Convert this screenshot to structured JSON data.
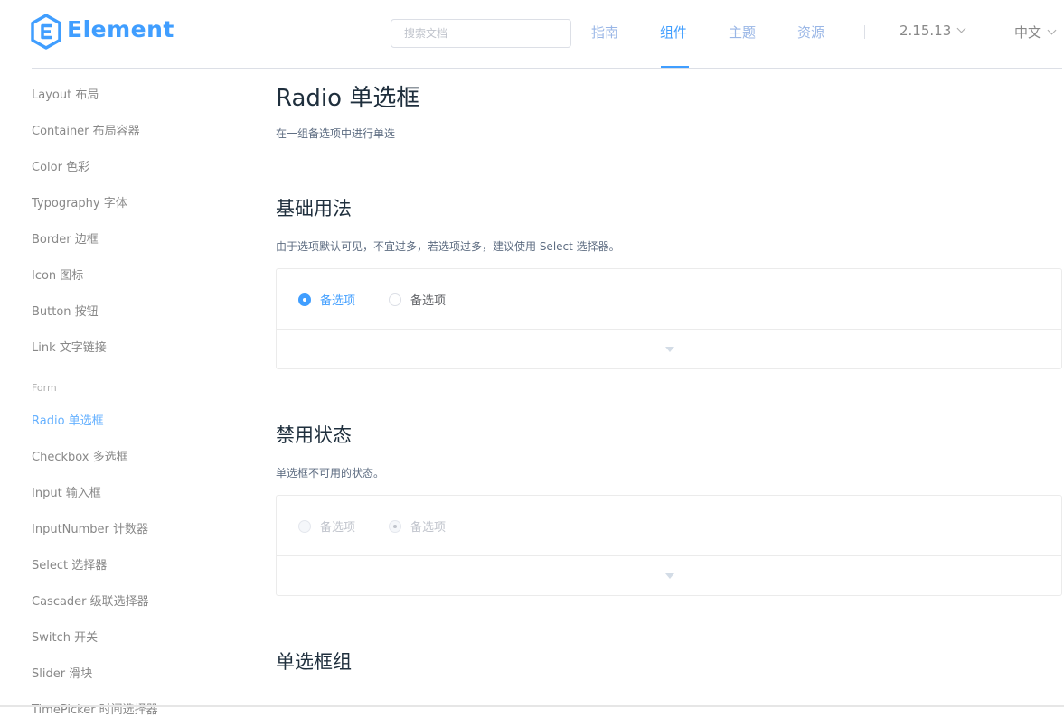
{
  "header": {
    "logo_text": "Element",
    "search_placeholder": "搜索文档",
    "nav": [
      {
        "label": "指南"
      },
      {
        "label": "组件"
      },
      {
        "label": "主题"
      },
      {
        "label": "资源"
      }
    ],
    "version": "2.15.13",
    "language": "中文"
  },
  "sidebar": {
    "items": [
      {
        "label": "Layout 布局"
      },
      {
        "label": "Container 布局容器"
      },
      {
        "label": "Color 色彩"
      },
      {
        "label": "Typography 字体"
      },
      {
        "label": "Border 边框"
      },
      {
        "label": "Icon 图标"
      },
      {
        "label": "Button 按钮"
      },
      {
        "label": "Link 文字链接"
      }
    ],
    "group_label": "Form",
    "form_items": [
      {
        "label": "Radio 单选框"
      },
      {
        "label": "Checkbox 多选框"
      },
      {
        "label": "Input 输入框"
      },
      {
        "label": "InputNumber 计数器"
      },
      {
        "label": "Select 选择器"
      },
      {
        "label": "Cascader 级联选择器"
      },
      {
        "label": "Switch 开关"
      },
      {
        "label": "Slider 滑块"
      },
      {
        "label": "TimePicker 时间选择器"
      }
    ]
  },
  "main": {
    "title": "Radio 单选框",
    "description": "在一组备选项中进行单选",
    "sections": [
      {
        "title": "基础用法",
        "description": "由于选项默认可见，不宜过多，若选项过多，建议使用 Select 选择器。",
        "options": [
          {
            "label": "备选项"
          },
          {
            "label": "备选项"
          }
        ]
      },
      {
        "title": "禁用状态",
        "description": "单选框不可用的状态。",
        "options": [
          {
            "label": "备选项"
          },
          {
            "label": "备选项"
          }
        ]
      },
      {
        "title": "单选框组"
      }
    ]
  },
  "colors": {
    "primary": "#409eff",
    "nav_inactive": "#99b6e6",
    "text_primary": "#1f2f3d",
    "text_secondary": "#5e6d82",
    "border": "#ebebeb"
  }
}
